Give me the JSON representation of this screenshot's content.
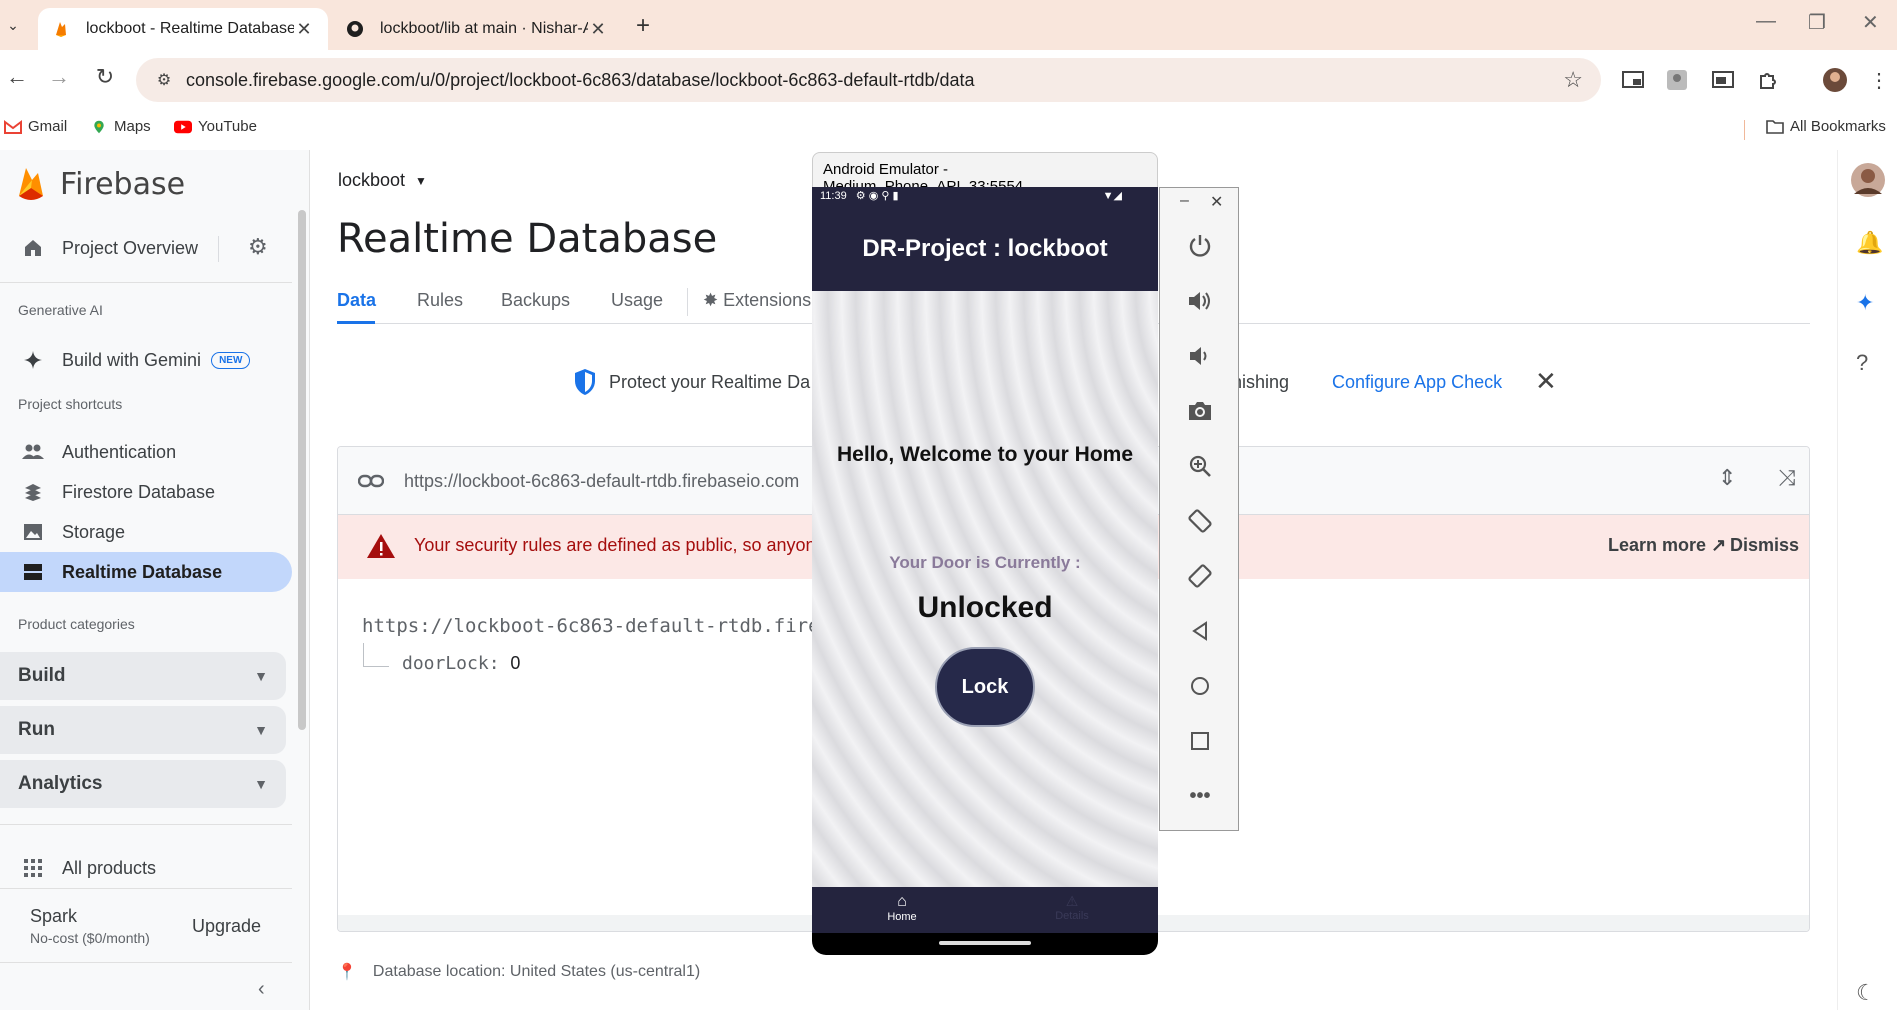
{
  "browser": {
    "tabs": [
      {
        "title": "lockboot - Realtime Database - ",
        "active": true
      },
      {
        "title": "lockboot/lib at main · Nishar-Al",
        "active": false
      }
    ],
    "address": "console.firebase.google.com/u/0/project/lockboot-6c863/database/lockboot-6c863-default-rtdb/data",
    "bookmarks": [
      "Gmail",
      "Maps",
      "YouTube"
    ],
    "all_bookmarks": "All Bookmarks"
  },
  "sidebar": {
    "brand": "Firebase",
    "project_overview": "Project Overview",
    "generative_ai_heading": "Generative AI",
    "build_with_gemini": "Build with Gemini",
    "new_badge": "NEW",
    "shortcuts_heading": "Project shortcuts",
    "shortcuts": [
      "Authentication",
      "Firestore Database",
      "Storage",
      "Realtime Database"
    ],
    "product_categories_heading": "Product categories",
    "categories": [
      "Build",
      "Run",
      "Analytics"
    ],
    "all_products": "All products",
    "plan_name": "Spark",
    "plan_desc": "No-cost ($0/month)",
    "upgrade": "Upgrade"
  },
  "main": {
    "project": "lockboot",
    "title": "Realtime Database",
    "tabs": [
      "Data",
      "Rules",
      "Backups",
      "Usage",
      "Extensions"
    ],
    "banner_left": "Protect your Realtime Da",
    "banner_right": "hishing",
    "configure_app_check": "Configure App Check",
    "db_url": "https://lockboot-6c863-default-rtdb.firebaseio.com",
    "warning": "Your security rules are defined as public, so anyone",
    "learn_more": "Learn more",
    "dismiss": "Dismiss",
    "tree_root": "https://lockboot-6c863-default-rtdb.firebas",
    "tree_key": "doorLock",
    "tree_value": "0",
    "location": "Database location: United States (us-central1)"
  },
  "emulator": {
    "window_title": "Android Emulator - Medium_Phone_API_33:5554",
    "time": "11:39",
    "app_title": "DR-Project : lockboot",
    "greeting": "Hello, Welcome to your Home",
    "door_label": "Your Door is Currently :",
    "door_state": "Unlocked",
    "lock_button": "Lock",
    "nav_home": "Home",
    "nav_details": "Details"
  },
  "colors": {
    "accent": "#1a73e8",
    "app_bar": "#24243e",
    "warning_bg": "#fce8e6",
    "warning_text": "#a50e0e",
    "active_nav": "#c2d7fb"
  }
}
